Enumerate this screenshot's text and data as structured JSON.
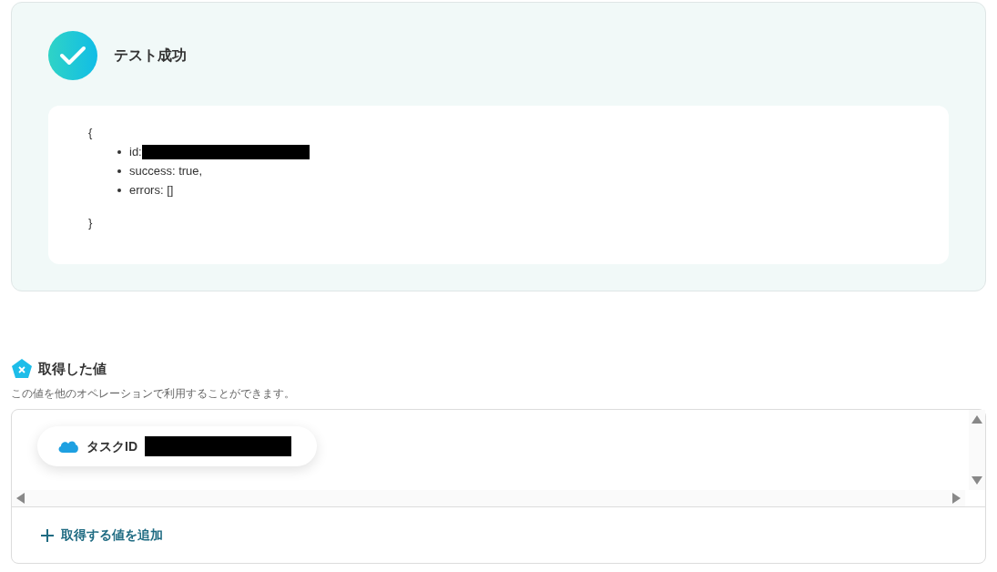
{
  "test_result": {
    "title": "テスト成功",
    "open_brace": "{",
    "items": [
      "id:",
      "success: true,",
      "errors: []"
    ],
    "close_brace": "}"
  },
  "values_section": {
    "title": "取得した値",
    "description": "この値を他のオペレーションで利用することができます。",
    "chips": [
      {
        "label": "タスクID"
      }
    ],
    "add_link": "取得する値を追加"
  }
}
